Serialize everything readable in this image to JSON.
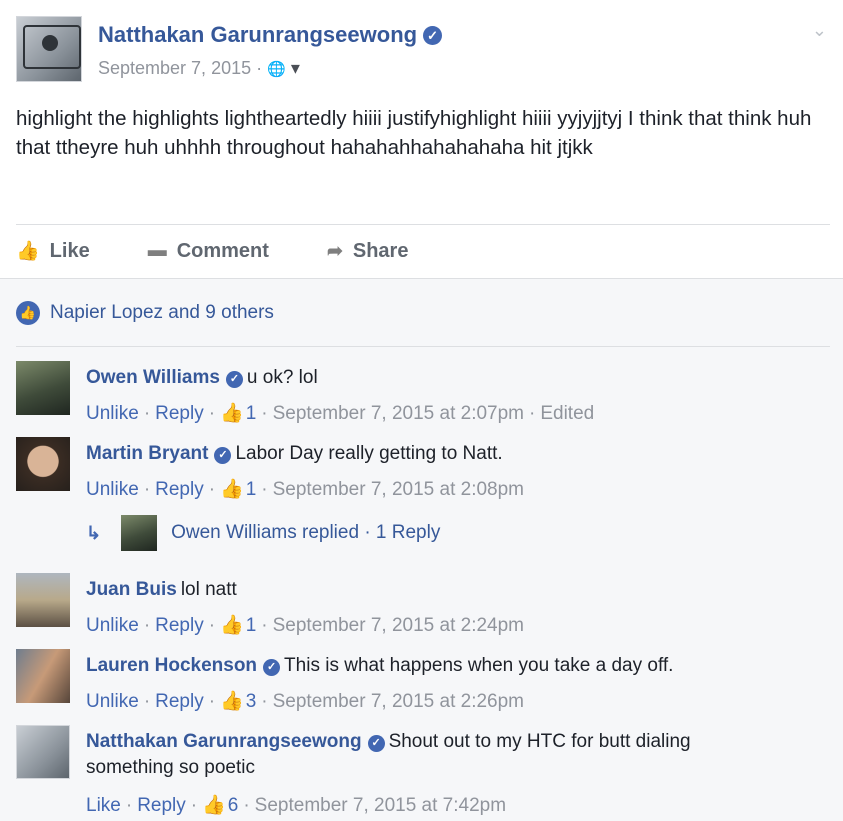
{
  "post": {
    "author": "Natthakan Garunrangseewong",
    "date": "September 7, 2015",
    "meta_sep": "·",
    "globe_icon": "🌐",
    "caret_icon": "▾",
    "chevron": "⌄",
    "text": "highlight the highlights lightheartedly hiiii justifyhighlight hiiii yyjyjjtyj I think that think huh that ttheyre huh uhhhh throughout hahahahhahahahaha hit jtjkk"
  },
  "actions": {
    "like": "Like",
    "comment": "Comment",
    "share": "Share"
  },
  "likes_summary": "Napier Lopez and 9 others",
  "comments": [
    {
      "name": "Owen Williams",
      "verified": true,
      "text": "u ok? lol",
      "action": "Unlike",
      "reply": "Reply",
      "likes": "1",
      "time": "September 7, 2015 at 2:07pm",
      "edited": "Edited"
    },
    {
      "name": "Martin Bryant",
      "verified": true,
      "text": "Labor Day really getting to Natt.",
      "action": "Unlike",
      "reply": "Reply",
      "likes": "1",
      "time": "September 7, 2015 at 2:08pm"
    },
    {
      "name": "Juan Buis",
      "verified": false,
      "text": "lol natt",
      "action": "Unlike",
      "reply": "Reply",
      "likes": "1",
      "time": "September 7, 2015 at 2:24pm"
    },
    {
      "name": "Lauren Hockenson",
      "verified": true,
      "text": "This is what happens when you take a day off.",
      "action": "Unlike",
      "reply": "Reply",
      "likes": "3",
      "time": "September 7, 2015 at 2:26pm"
    },
    {
      "name": "Natthakan Garunrangseewong",
      "verified": true,
      "text_line1": "Shout out to my HTC for butt dialing",
      "text_line2": "something so poetic",
      "action": "Like",
      "reply": "Reply",
      "likes": "6",
      "time": "September 7, 2015 at 7:42pm"
    }
  ],
  "reply_thread": {
    "text": "Owen Williams replied · 1 Reply"
  },
  "glyphs": {
    "sep": "·",
    "thumb": "👍",
    "check": "✓",
    "reply_arrow": "↳"
  },
  "colors": {
    "link": "#365899",
    "accent": "#4267b2",
    "meta": "#90949c",
    "comments_bg": "#f6f7f9"
  }
}
